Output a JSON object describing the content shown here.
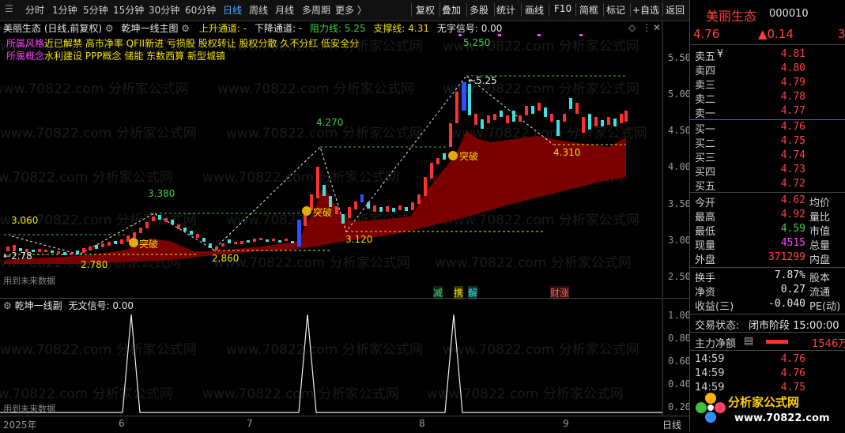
{
  "toolbar": {
    "periods": [
      "分时",
      "1分钟",
      "5分钟",
      "15分钟",
      "30分钟",
      "60分钟",
      "日线",
      "周线",
      "月线",
      "多周期",
      "更多 〉"
    ],
    "active_period": "日线",
    "actions": [
      "复权",
      "叠加",
      "多股",
      "统计",
      "画线",
      "F10",
      "简框",
      "标记",
      "+自选",
      "返回"
    ]
  },
  "main": {
    "stock_title": "美丽生态",
    "chart_mode": "(日线,前复权)",
    "indicator_name": "乾坤一线主图",
    "up_channel_label": "上升通道:",
    "up_channel_value": "-",
    "down_channel_label": "下降通道:",
    "down_channel_value": "-",
    "resistance_label": "阻力线:",
    "resistance_value": "5.25",
    "support_label": "支撑线:",
    "support_value": "4.31",
    "no_signal_label": "无字信号:",
    "no_signal_value": "0.00",
    "style_label": "所属风格",
    "style_text": "近已解禁 高市净率 QFII新进 亏损股 股权转让 股权分散 久不分红 低安全分",
    "concept_label": "所属概念",
    "concept_text": "水利建设 PPP概念 储能 东数西算 新型城镇",
    "future_data_note": "用到未来数据",
    "price_axis": [
      "5.50",
      "5.00",
      "4.50",
      "4.00",
      "3.50",
      "3.00",
      "2.50"
    ],
    "annotations": {
      "a3060": "3.060",
      "a2780": "2.780",
      "a278": "2.78",
      "a3380": "3.380",
      "a2860": "2.860",
      "a4270": "4.270",
      "a3120": "3.120",
      "a5250": "5.250",
      "a525": "5.25",
      "a4310": "4.310"
    },
    "breakout_label": "突破",
    "signal_tags": [
      "减",
      "携",
      "解",
      "财涨"
    ]
  },
  "sub": {
    "indicator_name": "乾坤一线副",
    "signal_label": "无文信号:",
    "signal_value": "0.00",
    "axis": [
      "1.00",
      "0.80",
      "0.60",
      "0.40",
      "0.20"
    ],
    "future_data_note": "用到未来数据"
  },
  "date_axis": {
    "labels": [
      "2025年",
      "6",
      "7",
      "8",
      "9"
    ],
    "period_tag": "日线"
  },
  "watermark": "www.70822.com 分析家公式网",
  "panel": {
    "name": "美丽生态",
    "code": "000010",
    "price": "4.76",
    "change": "▲0.14",
    "change_pct": "3",
    "asks": [
      {
        "label": "卖五",
        "value": "4.81"
      },
      {
        "label": "卖四",
        "value": "4.80"
      },
      {
        "label": "卖三",
        "value": "4.79"
      },
      {
        "label": "卖二",
        "value": "4.78"
      },
      {
        "label": "卖一",
        "value": "4.77"
      }
    ],
    "bids": [
      {
        "label": "买一",
        "value": "4.76"
      },
      {
        "label": "买二",
        "value": "4.75"
      },
      {
        "label": "买三",
        "value": "4.74"
      },
      {
        "label": "买四",
        "value": "4.73"
      },
      {
        "label": "买五",
        "value": "4.72"
      }
    ],
    "stats": [
      {
        "label": "今开",
        "value": "4.62",
        "label2": "均价"
      },
      {
        "label": "最高",
        "value": "4.92",
        "label2": "量比"
      },
      {
        "label": "最低",
        "value": "4.59",
        "label2": "市值"
      },
      {
        "label": "现量",
        "value": "4515",
        "label2": "总量"
      },
      {
        "label": "外盘",
        "value": "371299",
        "label2": "内盘"
      }
    ],
    "stats2": [
      {
        "label": "换手",
        "value": "7.87%",
        "label2": "股本"
      },
      {
        "label": "净资",
        "value": "0.27",
        "label2": "流通"
      },
      {
        "label": "收益(三)",
        "value": "-0.040",
        "label2": "PE(动)"
      }
    ],
    "trade_state_label": "交易状态:",
    "trade_state_value": "闭市阶段 15:00:00",
    "main_net_label": "主力净额",
    "main_net_value": "1546万",
    "ticks": [
      {
        "time": "14:59",
        "price": "4.76"
      },
      {
        "time": "14:59",
        "price": "4.76"
      },
      {
        "time": "14:59",
        "price": "4.75"
      }
    ],
    "logo_text": "分析家公式网",
    "logo_url": "www.70822.com"
  }
}
